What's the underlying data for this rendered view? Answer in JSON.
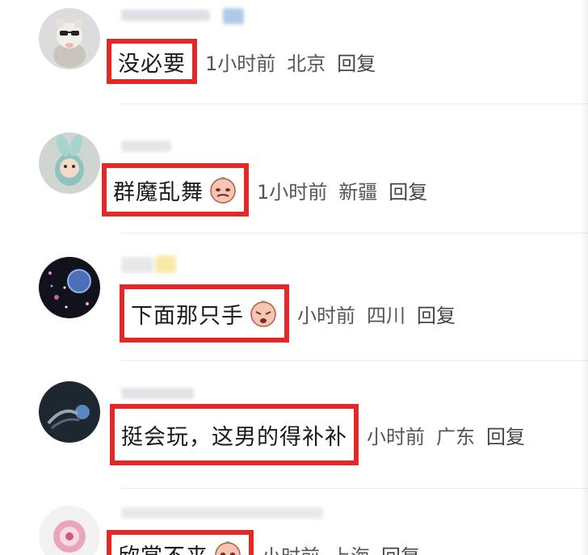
{
  "comments": [
    {
      "text": "没必要",
      "time": "1小时前",
      "location": "北京",
      "reply": "回复",
      "emoji": ""
    },
    {
      "text": "群魔乱舞",
      "time": "1小时前",
      "location": "新疆",
      "reply": "回复",
      "emoji": "sticker-face-icon"
    },
    {
      "text": "下面那只手",
      "time": "小时前",
      "location": "四川",
      "reply": "回复",
      "emoji": "sticker-face-icon"
    },
    {
      "text": "挺会玩，这男的得补补",
      "time": "小时前",
      "location": "广东",
      "reply": "回复",
      "emoji": ""
    },
    {
      "text": "欣赏不来",
      "time": "小时前",
      "location": "上海",
      "reply": "回复",
      "emoji": "sticker-face-icon"
    }
  ],
  "colors": {
    "highlight": "#e02a2a",
    "text": "#1a1a1a",
    "meta": "#555555"
  }
}
